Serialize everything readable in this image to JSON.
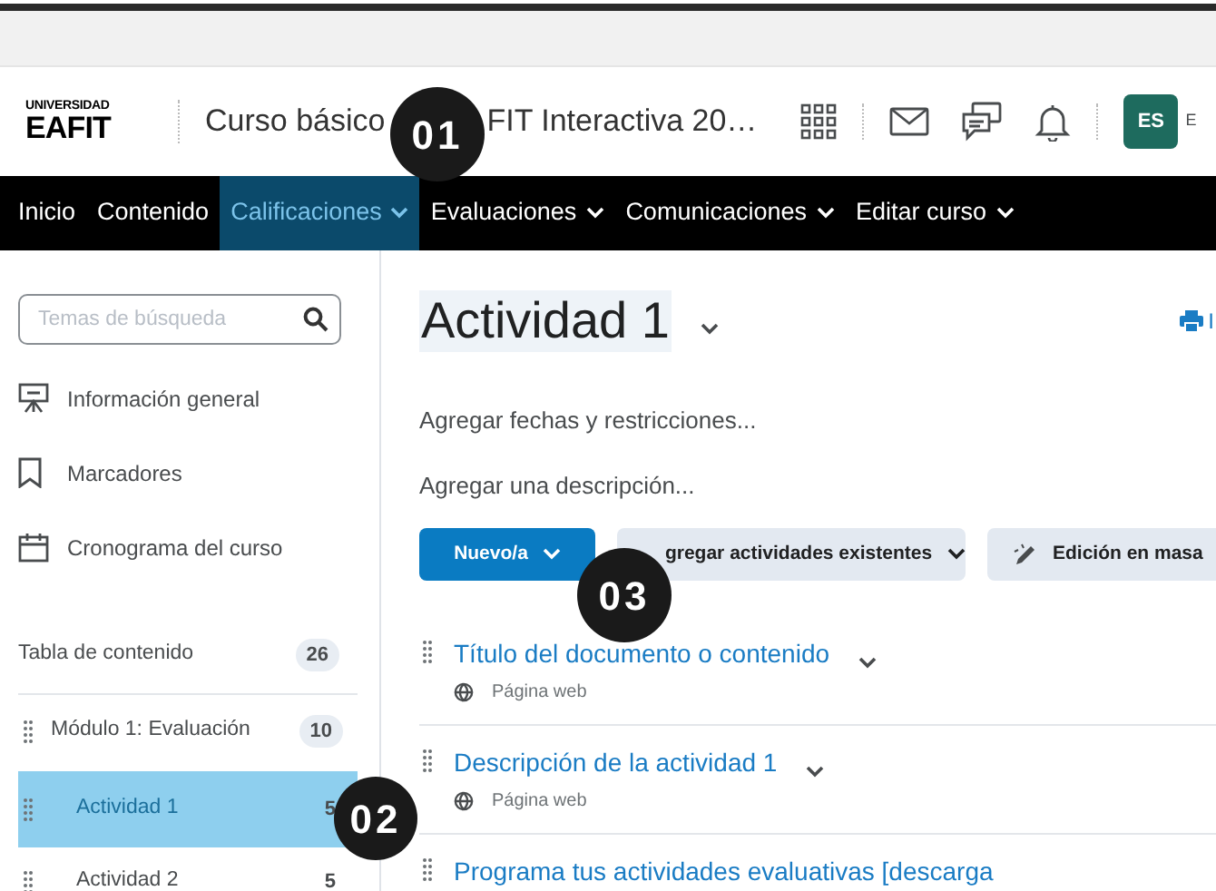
{
  "header": {
    "logo_top": "UNIVERSIDAD",
    "logo_main": "EAFIT",
    "course_title_start": "Curso básico",
    "course_title_end": "FIT Interactiva 20…",
    "avatar": "ES",
    "cut_name": "E"
  },
  "nav": [
    {
      "label": "Inicio",
      "dropdown": false,
      "selected": false
    },
    {
      "label": "Contenido",
      "dropdown": false,
      "selected": false
    },
    {
      "label": "Calificaciones",
      "dropdown": true,
      "selected": true
    },
    {
      "label": "Evaluaciones",
      "dropdown": true,
      "selected": false
    },
    {
      "label": "Comunicaciones",
      "dropdown": true,
      "selected": false
    },
    {
      "label": "Editar curso",
      "dropdown": true,
      "selected": false
    }
  ],
  "sidebar": {
    "search": {
      "placeholder": "Temas de búsqueda"
    },
    "links": [
      {
        "kind": "presentation",
        "label": "Información general"
      },
      {
        "kind": "bookmark",
        "label": "Marcadores"
      },
      {
        "kind": "calendar",
        "label": "Cronograma del curso"
      }
    ],
    "toc": {
      "label": "Tabla de contenido",
      "count": "26",
      "children": [
        {
          "label": "Módulo 1: Evaluación",
          "count": "10",
          "selected": false,
          "children": [
            {
              "label": "Actividad 1",
              "count": "5",
              "selected": true
            },
            {
              "label": "Actividad 2",
              "count": "5",
              "selected": false
            }
          ]
        }
      ]
    }
  },
  "content": {
    "title": "Actividad 1",
    "print_label": "I",
    "add_dates": "Agregar fechas y restricciones...",
    "add_description": "Agregar una descripción...",
    "buttons": [
      {
        "kind": "primary",
        "label": "Nuevo/a"
      },
      {
        "kind": "dropdown",
        "label": "gregar actividades existentes"
      },
      {
        "kind": "bulk",
        "label": "Edición en masa"
      }
    ],
    "items": [
      {
        "title": "Título del documento o contenido",
        "type": "Página web"
      },
      {
        "title": "Descripción de la actividad 1",
        "type": "Página web"
      },
      {
        "title": "Programa tus actividades evaluativas [descarga"
      }
    ]
  },
  "callouts": [
    {
      "label": "01"
    },
    {
      "label": "02"
    },
    {
      "label": "03"
    }
  ]
}
